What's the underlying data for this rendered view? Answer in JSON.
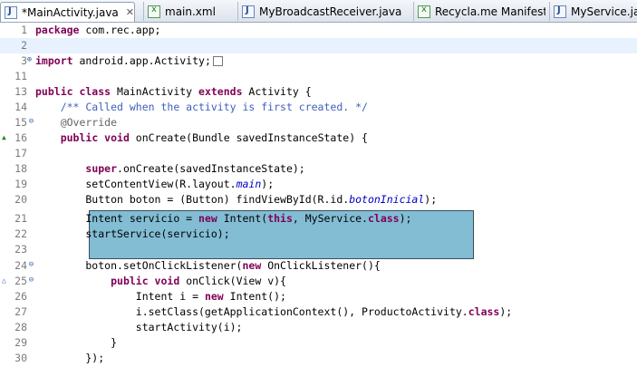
{
  "tabs": [
    {
      "label": "*MainActivity.java",
      "icon": "java-file-icon",
      "active": true,
      "close": "✕"
    },
    {
      "label": "main.xml",
      "icon": "xml-file-icon"
    },
    {
      "label": "MyBroadcastReceiver.java",
      "icon": "java-file-icon"
    },
    {
      "label": "Recycla.me Manifest",
      "icon": "xml-file-icon"
    },
    {
      "label": "MyService.java",
      "icon": "java-file-icon"
    }
  ],
  "lines": [
    {
      "num": "1",
      "text": "package com.rec.app;"
    },
    {
      "num": "2",
      "text": ""
    },
    {
      "num": "3",
      "text": "import android.app.Activity;"
    },
    {
      "num": "11",
      "text": ""
    },
    {
      "num": "13",
      "text": "public class MainActivity extends Activity {"
    },
    {
      "num": "14",
      "text": "    /** Called when the activity is first created. */"
    },
    {
      "num": "15",
      "text": "    @Override"
    },
    {
      "num": "16",
      "text": "    public void onCreate(Bundle savedInstanceState) {"
    },
    {
      "num": "17",
      "text": ""
    },
    {
      "num": "18",
      "text": "        super.onCreate(savedInstanceState);"
    },
    {
      "num": "19",
      "text": "        setContentView(R.layout.main);"
    },
    {
      "num": "20",
      "text": "        Button boton = (Button) findViewById(R.id.botonInicial);"
    },
    {
      "num": "21",
      "text": "        Intent servicio = new Intent(this, MyService.class);"
    },
    {
      "num": "22",
      "text": "        startService(servicio);"
    },
    {
      "num": "23",
      "text": ""
    },
    {
      "num": "24",
      "text": "        boton.setOnClickListener(new OnClickListener(){"
    },
    {
      "num": "25",
      "text": "            public void onClick(View v){"
    },
    {
      "num": "26",
      "text": "                Intent i = new Intent();"
    },
    {
      "num": "27",
      "text": "                i.setClass(getApplicationContext(), ProductoActivity.class);"
    },
    {
      "num": "28",
      "text": "                startActivity(i);"
    },
    {
      "num": "29",
      "text": "            }"
    },
    {
      "num": "30",
      "text": "        });"
    }
  ],
  "colors": {
    "keyword": "#7f0055",
    "comment": "#3f5fbf",
    "annotation": "#646464",
    "field": "#0000c0",
    "highlight": "#82bdd4",
    "current_line": "#e8f2fe"
  }
}
